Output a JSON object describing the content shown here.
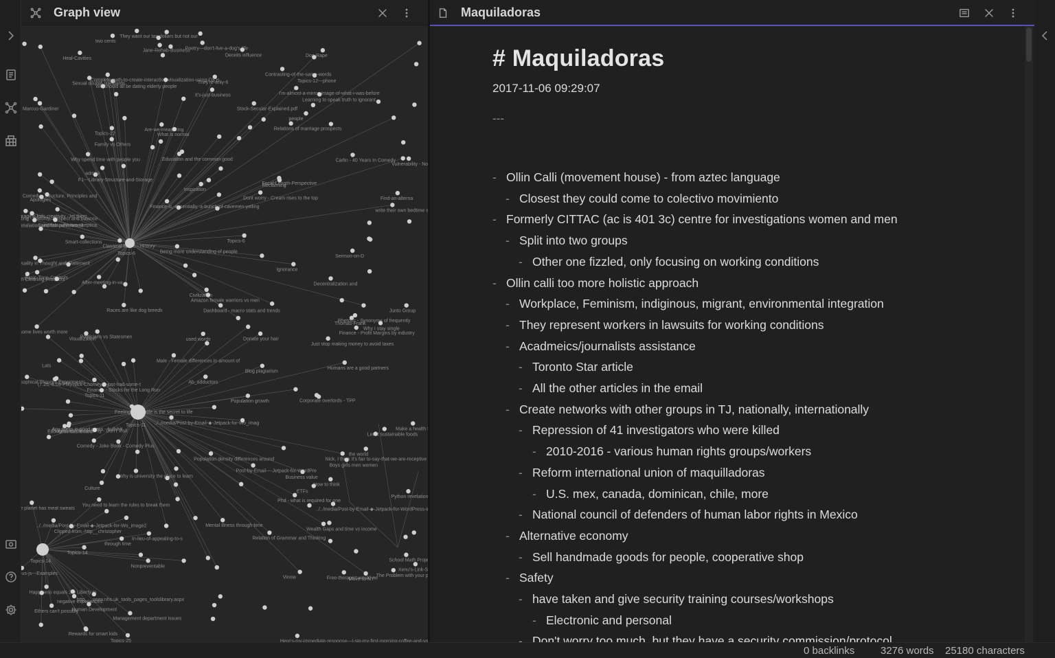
{
  "graph_pane": {
    "title": "Graph view",
    "icons": [
      "graph-icon",
      "close-icon",
      "more-options-icon"
    ],
    "hubs": [
      {
        "label": "Topics-6"
      },
      {
        "label": "Topics-11"
      },
      {
        "label": "Topics-14"
      }
    ],
    "node_labels": [
      "They want our tax dollars but not our",
      "two cents",
      "Poetry---don't-live-a-dog's-life",
      "Heal-Cavities",
      "Deceits influence",
      "Jane-Rehab-Business",
      "Dog-Rape",
      "They're-only-6",
      "We should all be dating elderly people",
      "Complete-path-to-create-interactive-visualization-using-D3.js",
      "Contrasting-of-the-same-words",
      "Topics-12---phone",
      "Sexual double standards",
      "I'm-almost-a-mirror-image-of-what-i-was-before",
      "It's-just-business",
      "Learning to speak truth to ignorant",
      "people",
      "Stock-Secular-Explained.pdf",
      "Marcus-Gardiner",
      "Are-we-measuring",
      "Relations of marriage prospects",
      "Family vs Others",
      "Topics-22",
      "What is normal",
      "Education and the common good",
      "Vulnerability - Note to Jason about Julie",
      "Carlin - 40 Years In Comedy",
      "Why spend time with people you",
      "admire",
      "Reclaiming",
      "F1---Library-Structure-and-Storage",
      "Comedy - Structure, Principles and",
      "Inspiration",
      "Apologies",
      "Focal-Length-Perspective",
      "Finance-is,-essentially,-a-bunch-of-cavemen-yelling",
      "Find-an-alterna",
      "Dont worry - Cream rises to the top",
      "Encouraging kids creativity - let them",
      "write their own bedtime stories",
      "Dating - Maturity, Respect and balance",
      "Retaliation and fair punishment",
      "Smart-collections",
      "Scientists-who-are-skeptica",
      "Topics-6",
      "Classical Music - History",
      "Being more understanding of people",
      "Ignorance",
      "Sermon-on-D",
      "---Basic-Tone-Controls",
      "Quality in Thought and Statement",
      "Green-Cleaning-Products",
      "After-meeting-in-va",
      "Decentralization and",
      "Civilization",
      "Amazon female warriors vs men",
      "Dashboard - macro stats and trends",
      "Races are like dog breeds",
      "Junto Group",
      "Thomas-Frank",
      "some lives worth more",
      "Rhetoric - Synonyms of frequently",
      "Why I stay single",
      "used words",
      "Politicians vs Statesmen",
      "Finance - Profit Margins by industry",
      "Donate your hair",
      "Visualization",
      "Just stop making money to avoid taxes",
      "Lats",
      "Male - Female differences in amount of",
      "Humans are a good partners",
      "Blog plagiarism",
      "Ab_adductors",
      "(7.25,-3.09-PM)-Nick-Chomey,-I-just-had-some-t",
      "Finance - Stocks for the Long Run",
      "Philosophical Thought Experiments",
      "Corporate overlords - TPP",
      "Population growth",
      "Topics-11",
      "../../media/Post-by-Email-◆-Jetpack-for-Wo_imag",
      "Feeling in a bottle is the secret to life",
      "Any press is good press - bullshit",
      "Progression to celebrity - Don't Visit",
      "Make a health foundation is bullshit",
      "Least sustainable foods",
      "Economic dashboard",
      "Nick, I think it's fair to-say-that-we-are-receptive",
      "Comedy - Joke Book - Comedy Plus",
      "Population density differences around",
      "the world",
      "Post-by-Email----Jetpack-for-WordPre",
      "Boys girls men women",
      "Why is university the place to learn",
      "Culture",
      "How to think",
      "Business value",
      "You need to learn the rules to break them",
      "Python revelation - question everything",
      "ETFs",
      "Phd - what is required for one",
      "The planet has meat sweats",
      "Mental illness through time",
      "../../media/Post-by-Email-◆-Jetpack-for-WordPress-image2_08344570",
      "../../media/Post-by-Email-◆-Jetpack-for-Wo_image2",
      "Clipped-from,-http__christopher",
      "Relation of Grammar and Thinking",
      "Wealth Gaps and time vs income",
      "through time",
      "In-lieu-of-appealing-to-s",
      "Topics-14",
      "Xenu's-Link-Sleuth---More-Than-Just-A-Broken-Links-Finder---Moz",
      "Linkurious-js---Examples",
      "The Problem with your perspective is",
      "School Math Project Ideas",
      "Nonpreventable",
      "Vinnie",
      "Free-therapist-would-ne",
      "Move-to-NY",
      "Happiness equals 2.0 Liberty to",
      "negative experiences",
      "Management department issues",
      "http___www.nhs.uk_tools_pages_toolslibrary.aspx",
      "Ethers can't possibly",
      "Human Development",
      "Rewards for smart kids",
      "Topics-25",
      "Here's-my-immediate-response---I-sip-my-first-morning-coffee-and-your"
    ]
  },
  "note_pane": {
    "title": "Maquiladoras",
    "heading": "# Maquiladoras",
    "date": "2017-11-06 09:29:07",
    "separator": "---",
    "items": [
      {
        "level": 0,
        "text": "Ollin Calli (movement house) - from aztec language"
      },
      {
        "level": 1,
        "text": "Closest they could come to colectivo movimiento"
      },
      {
        "level": 0,
        "text": "Formerly CITTAC (ac is 401 3c) centre for investigations women and men"
      },
      {
        "level": 1,
        "text": "Split into two groups"
      },
      {
        "level": 2,
        "text": "Other one fizzled, only focusing on working conditions"
      },
      {
        "level": 0,
        "text": "Ollin calli too more holistic approach"
      },
      {
        "level": 1,
        "text": "Workplace, Feminism, indiginous, migrant, environmental integration"
      },
      {
        "level": 1,
        "text": "They represent workers in lawsuits for working conditions"
      },
      {
        "level": 1,
        "text": "Acadmeics/journalists assistance"
      },
      {
        "level": 2,
        "text": "Toronto Star article"
      },
      {
        "level": 2,
        "text": "All the other articles in the email"
      },
      {
        "level": 1,
        "text": "Create networks with other groups in TJ, nationally, internationally"
      },
      {
        "level": 2,
        "text": "Repression of 41 investigators who were killed"
      },
      {
        "level": 3,
        "text": "2010-2016 - various human rights groups/workers"
      },
      {
        "level": 2,
        "text": "Reform international union of maquilladoras"
      },
      {
        "level": 3,
        "text": "U.S. mex, canada, dominican, chile, more"
      },
      {
        "level": 2,
        "text": "National council of defenders of human labor rights in Mexico"
      },
      {
        "level": 1,
        "text": "Alternative economy"
      },
      {
        "level": 2,
        "text": "Sell handmade goods for people, cooperative shop"
      },
      {
        "level": 1,
        "text": "Safety"
      },
      {
        "level": 2,
        "text": "have taken and give security training courses/workshops"
      },
      {
        "level": 3,
        "text": "Electronic and personal"
      },
      {
        "level": 2,
        "text": "Don't worry too much, but they have a security commission/protocol"
      }
    ]
  },
  "status": {
    "backlinks": "0 backlinks",
    "words": "3276 words",
    "characters": "25180 characters"
  },
  "colors": {
    "accent": "#5b4fc4",
    "background": "#1e1e1e",
    "graph_bg": "#262626",
    "node": "#cfcfcf",
    "edge": "#575757"
  }
}
